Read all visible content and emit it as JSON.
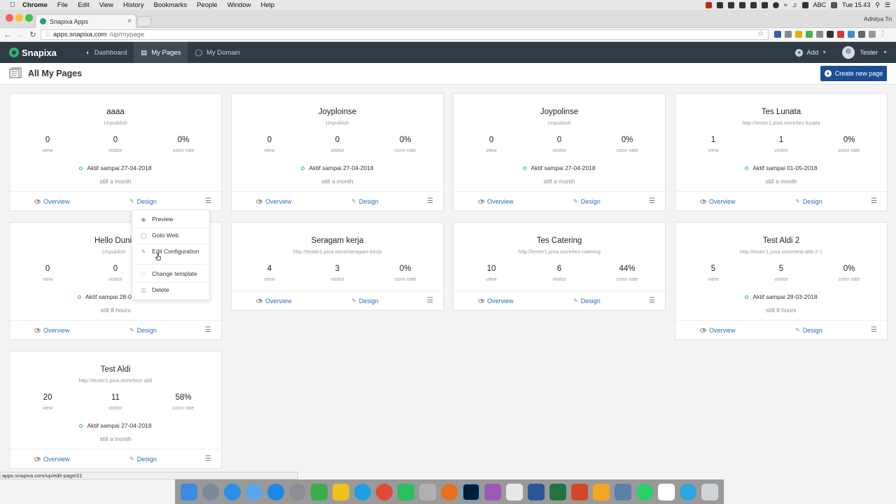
{
  "menubar": {
    "app": "Chrome",
    "items": [
      "File",
      "Edit",
      "View",
      "History",
      "Bookmarks",
      "People",
      "Window",
      "Help"
    ],
    "clock": "Tue 15.43",
    "input_source": "ABC"
  },
  "browser": {
    "tab_title": "Snapixa Apps",
    "profile": "Adhitya Tri",
    "url_host": "apps.snapixa.com",
    "url_path": "/up/mypage",
    "status_url": "apps.snapixa.com/up/edit-page/21"
  },
  "app": {
    "logo": "Snapixa",
    "nav": [
      {
        "label": "Dashboard",
        "icon": "dashboard-icon"
      },
      {
        "label": "My Pages",
        "icon": "pages-icon"
      },
      {
        "label": "My Domain",
        "icon": "globe-icon"
      }
    ],
    "add_label": "Add",
    "user_label": "Tester"
  },
  "page": {
    "title": "All My Pages",
    "create_label": "Create new page",
    "accent": "#1d4e94",
    "status_color": "#2bb673"
  },
  "labels": {
    "view": "view",
    "visitor": "visitor",
    "conv": "conv rate",
    "overview": "Overview",
    "design": "Design"
  },
  "cards": [
    {
      "title": "aaaa",
      "sub": "Unpublish",
      "view": "0",
      "visitor": "0",
      "conv": "0%",
      "active": "Aktif sampai 27-04-2018",
      "ago": "still a month"
    },
    {
      "title": "Joyploinse",
      "sub": "Unpublish",
      "view": "0",
      "visitor": "0",
      "conv": "0%",
      "active": "Aktif sampai 27-04-2018",
      "ago": "still a month"
    },
    {
      "title": "Joypolinse",
      "sub": "Unpublish",
      "view": "0",
      "visitor": "0",
      "conv": "0%",
      "active": "Aktif sampai 27-04-2018",
      "ago": "still a month"
    },
    {
      "title": "Tes Lunata",
      "sub": "http://tester1.pixa.store/tes-lunata",
      "view": "1",
      "visitor": "1",
      "conv": "0%",
      "active": "Aktif sampai 01-05-2018",
      "ago": "still a month"
    },
    {
      "title": "Hello Duni",
      "sub": "Unpublish",
      "view": "0",
      "visitor": "0",
      "conv": "",
      "active": "Aktif sampai 28-0",
      "ago": "still 8 hours"
    },
    {
      "title": "Seragam kerja",
      "sub": "http://tester1.pixa.store/seragam-kerja",
      "view": "4",
      "visitor": "3",
      "conv": "0%"
    },
    {
      "title": "Tes Catering",
      "sub": "http://tester1.pixa.store/tes-catering",
      "view": "10",
      "visitor": "6",
      "conv": "44%"
    },
    {
      "title": "Test Aldi 2",
      "sub": "http://tester1.pixa.store/test-aldi-2-1",
      "view": "5",
      "visitor": "5",
      "conv": "0%",
      "active": "Aktif sampai 28-03-2018",
      "ago": "still 8 hours"
    },
    {
      "title": "Test Aldi",
      "sub": "http://tester1.pixa.store/test-aldi",
      "view": "20",
      "visitor": "11",
      "conv": "58%",
      "active": "Aktif sampai 27-04-2018",
      "ago": "still a month"
    }
  ],
  "dropdown": {
    "preview": "Preview",
    "goto": "Goto Web",
    "config": "Edit Configuration",
    "template": "Change template",
    "delete": "Delete"
  }
}
